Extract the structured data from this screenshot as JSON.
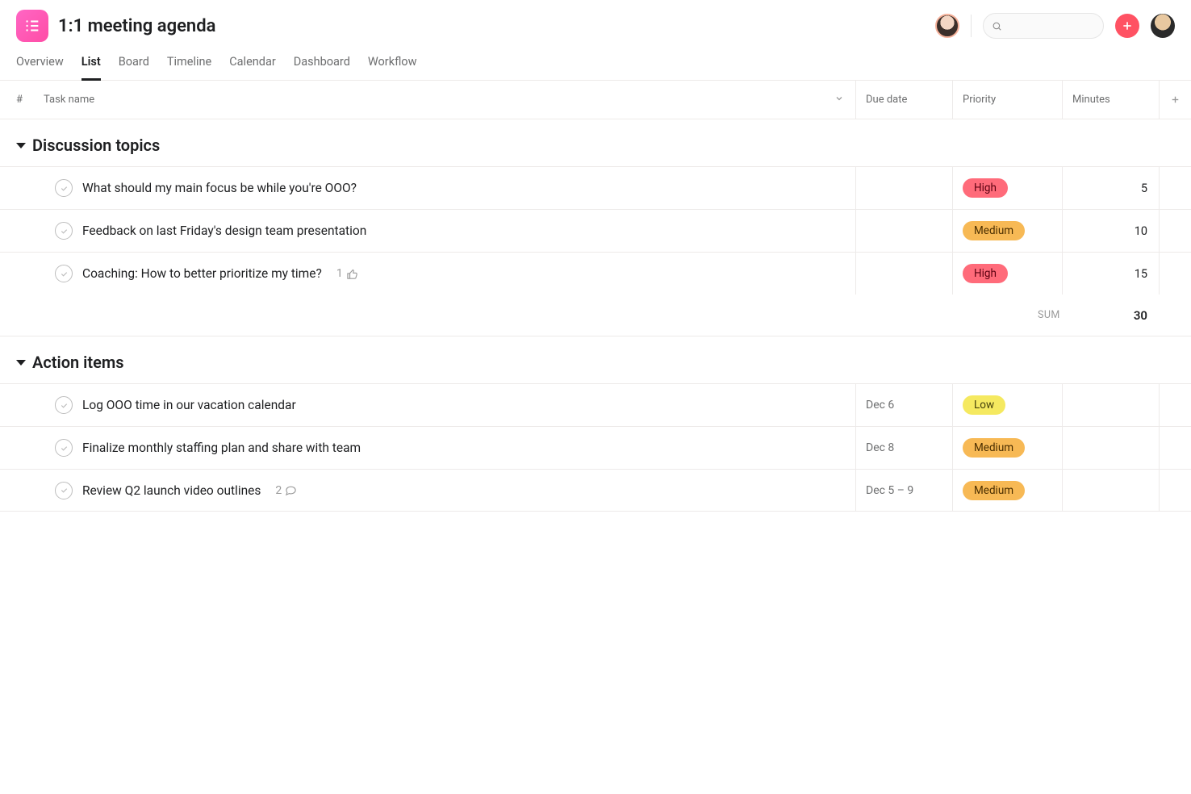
{
  "project": {
    "title": "1:1 meeting agenda"
  },
  "tabs": {
    "overview": "Overview",
    "list": "List",
    "board": "Board",
    "timeline": "Timeline",
    "calendar": "Calendar",
    "dashboard": "Dashboard",
    "workflow": "Workflow"
  },
  "columns": {
    "num": "#",
    "task": "Task name",
    "due": "Due date",
    "priority": "Priority",
    "minutes": "Minutes"
  },
  "priority_labels": {
    "high": "High",
    "medium": "Medium",
    "low": "Low"
  },
  "sections": [
    {
      "name": "Discussion topics",
      "tasks": [
        {
          "name": "What should my main focus be while you're OOO?",
          "due": "",
          "priority": "high",
          "minutes": "5",
          "likes": "",
          "comments": ""
        },
        {
          "name": "Feedback on last Friday's design team presentation",
          "due": "",
          "priority": "medium",
          "minutes": "10",
          "likes": "",
          "comments": ""
        },
        {
          "name": "Coaching: How to better prioritize my time?",
          "due": "",
          "priority": "high",
          "minutes": "15",
          "likes": "1",
          "comments": ""
        }
      ],
      "sum_label": "SUM",
      "sum_value": "30"
    },
    {
      "name": "Action items",
      "tasks": [
        {
          "name": "Log OOO time in our vacation calendar",
          "due": "Dec 6",
          "priority": "low",
          "minutes": "",
          "likes": "",
          "comments": ""
        },
        {
          "name": "Finalize monthly staffing plan and share with team",
          "due": "Dec 8",
          "priority": "medium",
          "minutes": "",
          "likes": "",
          "comments": ""
        },
        {
          "name": "Review Q2 launch video outlines",
          "due": "Dec 5 – 9",
          "priority": "medium",
          "minutes": "",
          "likes": "",
          "comments": "2"
        }
      ]
    }
  ],
  "search": {
    "placeholder": ""
  }
}
